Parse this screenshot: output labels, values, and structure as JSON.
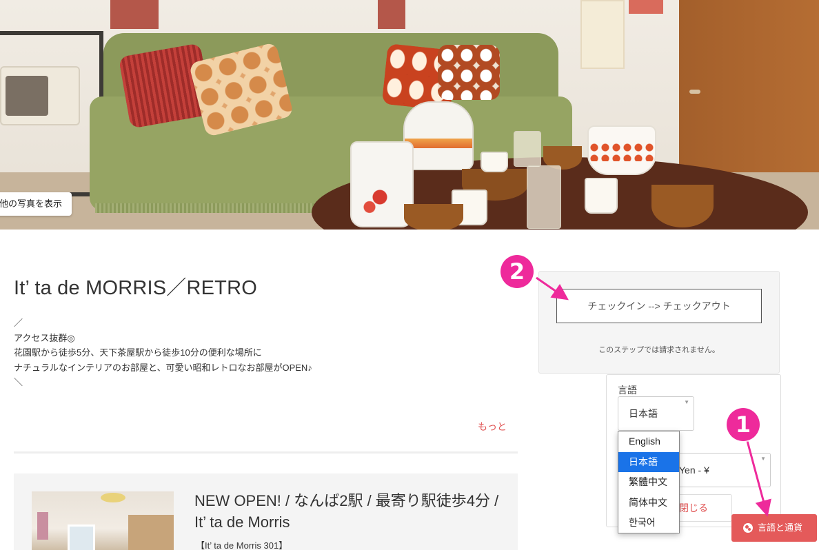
{
  "hero": {
    "show_photos_label": "他の写真を表示"
  },
  "listing": {
    "title": "It’ ta de MORRIS／RETRO",
    "description_lines": [
      "／",
      "アクセス抜群◎",
      "花園駅から徒歩5分、天下茶屋駅から徒歩10分の便利な場所に",
      "ナチュラルなインテリアのお部屋と、可愛い昭和レトロなお部屋がOPEN♪",
      "＼"
    ],
    "more_label": "もっと"
  },
  "related_card": {
    "title": "NEW OPEN! / なんば2駅 / 最寄り駅徒歩4分 / It’ ta de Morris",
    "subtitle": "【It’ ta de Morris 301】"
  },
  "booking": {
    "date_button_label": "チェックイン --> チェックアウト",
    "no_charge_note": "このステップでは請求されません。"
  },
  "language_panel": {
    "language_label": "言語",
    "selected_language": "日本語",
    "selected_currency": "Yen - ¥",
    "close_label": "閉じる",
    "options": [
      "English",
      "日本語",
      "繁體中文",
      "简体中文",
      "한국어"
    ],
    "selected_index": 1,
    "toggle_label": "言語と通貨",
    "toggle_icon": "globe-icon"
  },
  "annotations": {
    "badge_1": "1",
    "badge_2": "2",
    "color": "#ee2a9b"
  },
  "colors": {
    "accent": "#e45a5a",
    "selected_option": "#1a73e8"
  }
}
